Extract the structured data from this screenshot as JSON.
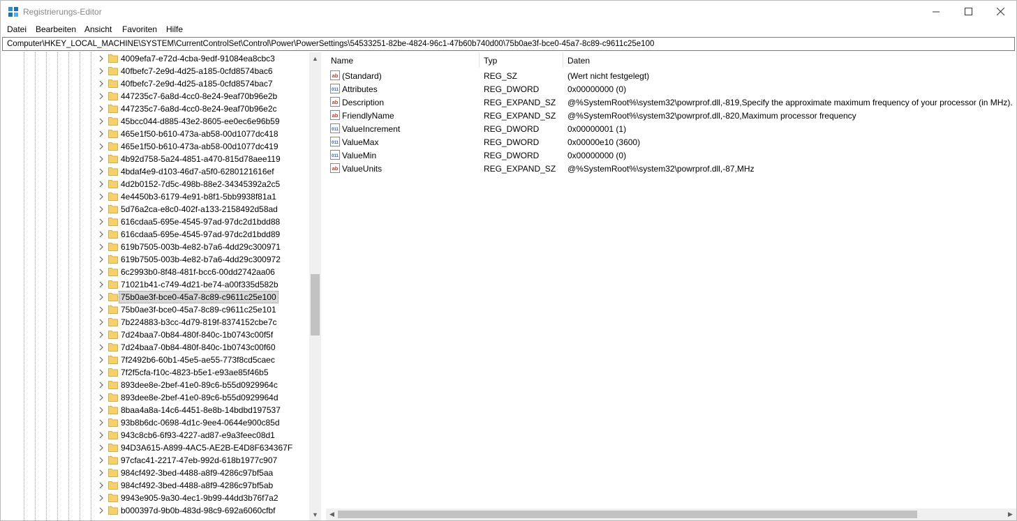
{
  "window": {
    "title": "Registrierungs-Editor"
  },
  "menu": [
    "Datei",
    "Bearbeiten",
    "Ansicht",
    "Favoriten",
    "Hilfe"
  ],
  "address": "Computer\\HKEY_LOCAL_MACHINE\\SYSTEM\\CurrentControlSet\\Control\\Power\\PowerSettings\\54533251-82be-4824-96c1-47b60b740d00\\75b0ae3f-bce0-45a7-8c89-c9611c25e100",
  "tree": {
    "selected_index": 19,
    "items": [
      "4009efa7-e72d-4cba-9edf-91084ea8cbc3",
      "40fbefc7-2e9d-4d25-a185-0cfd8574bac6",
      "40fbefc7-2e9d-4d25-a185-0cfd8574bac7",
      "447235c7-6a8d-4cc0-8e24-9eaf70b96e2b",
      "447235c7-6a8d-4cc0-8e24-9eaf70b96e2c",
      "45bcc044-d885-43e2-8605-ee0ec6e96b59",
      "465e1f50-b610-473a-ab58-00d1077dc418",
      "465e1f50-b610-473a-ab58-00d1077dc419",
      "4b92d758-5a24-4851-a470-815d78aee119",
      "4bdaf4e9-d103-46d7-a5f0-6280121616ef",
      "4d2b0152-7d5c-498b-88e2-34345392a2c5",
      "4e4450b3-6179-4e91-b8f1-5bb9938f81a1",
      "5d76a2ca-e8c0-402f-a133-2158492d58ad",
      "616cdaa5-695e-4545-97ad-97dc2d1bdd88",
      "616cdaa5-695e-4545-97ad-97dc2d1bdd89",
      "619b7505-003b-4e82-b7a6-4dd29c300971",
      "619b7505-003b-4e82-b7a6-4dd29c300972",
      "6c2993b0-8f48-481f-bcc6-00dd2742aa06",
      "71021b41-c749-4d21-be74-a00f335d582b",
      "75b0ae3f-bce0-45a7-8c89-c9611c25e100",
      "75b0ae3f-bce0-45a7-8c89-c9611c25e101",
      "7b224883-b3cc-4d79-819f-8374152cbe7c",
      "7d24baa7-0b84-480f-840c-1b0743c00f5f",
      "7d24baa7-0b84-480f-840c-1b0743c00f60",
      "7f2492b6-60b1-45e5-ae55-773f8cd5caec",
      "7f2f5cfa-f10c-4823-b5e1-e93ae85f46b5",
      "893dee8e-2bef-41e0-89c6-b55d0929964c",
      "893dee8e-2bef-41e0-89c6-b55d0929964d",
      "8baa4a8a-14c6-4451-8e8b-14bdbd197537",
      "93b8b6dc-0698-4d1c-9ee4-0644e900c85d",
      "943c8cb6-6f93-4227-ad87-e9a3feec08d1",
      "94D3A615-A899-4AC5-AE2B-E4D8F634367F",
      "97cfac41-2217-47eb-992d-618b1977c907",
      "984cf492-3bed-4488-a8f9-4286c97bf5aa",
      "984cf492-3bed-4488-a8f9-4286c97bf5ab",
      "9943e905-9a30-4ec1-9b99-44dd3b76f7a2",
      "b000397d-9b0b-483d-98c9-692a6060cfbf"
    ]
  },
  "columns": {
    "name": "Name",
    "type": "Typ",
    "data": "Daten"
  },
  "values": [
    {
      "icon": "string-value-icon",
      "name": "(Standard)",
      "type": "REG_SZ",
      "data": "(Wert nicht festgelegt)"
    },
    {
      "icon": "binary-value-icon",
      "name": "Attributes",
      "type": "REG_DWORD",
      "data": "0x00000000 (0)"
    },
    {
      "icon": "string-value-icon",
      "name": "Description",
      "type": "REG_EXPAND_SZ",
      "data": "@%SystemRoot%\\system32\\powrprof.dll,-819,Specify the approximate maximum frequency of your processor (in MHz)."
    },
    {
      "icon": "string-value-icon",
      "name": "FriendlyName",
      "type": "REG_EXPAND_SZ",
      "data": "@%SystemRoot%\\system32\\powrprof.dll,-820,Maximum processor frequency"
    },
    {
      "icon": "binary-value-icon",
      "name": "ValueIncrement",
      "type": "REG_DWORD",
      "data": "0x00000001 (1)"
    },
    {
      "icon": "binary-value-icon",
      "name": "ValueMax",
      "type": "REG_DWORD",
      "data": "0x00000e10 (3600)"
    },
    {
      "icon": "binary-value-icon",
      "name": "ValueMin",
      "type": "REG_DWORD",
      "data": "0x00000000 (0)"
    },
    {
      "icon": "string-value-icon",
      "name": "ValueUnits",
      "type": "REG_EXPAND_SZ",
      "data": "@%SystemRoot%\\system32\\powrprof.dll,-87,MHz"
    }
  ],
  "colors": {
    "folder": "#f6d16b",
    "folder_dark": "#dcae3e",
    "selection": "#d9d9d9",
    "string_icon": "#c0392b",
    "binary_icon": "#2e5cb8"
  }
}
